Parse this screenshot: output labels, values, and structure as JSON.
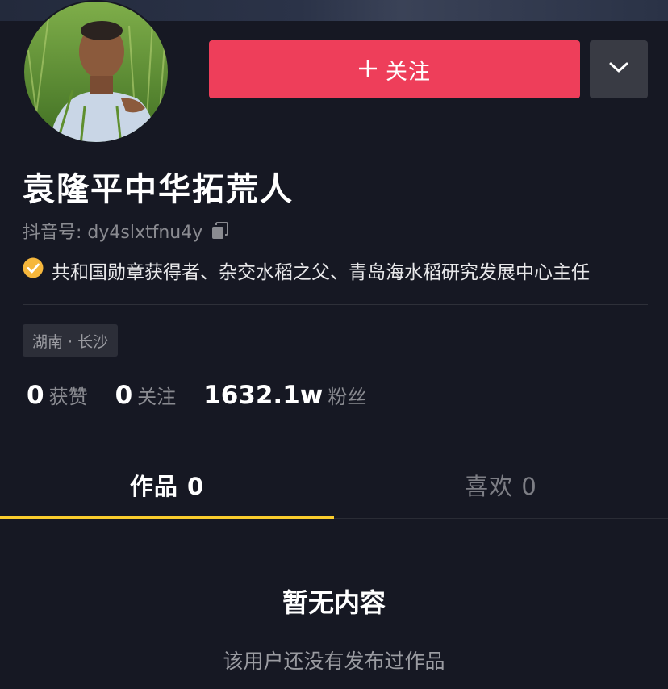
{
  "profile": {
    "nickname": "袁隆平中华拓荒人",
    "douyin_id_label": "抖音号: dy4slxtfnu4y",
    "verification": "共和国勋章获得者、杂交水稻之父、青岛海水稻研究发展中心主任",
    "location": "湖南 · 长沙"
  },
  "actions": {
    "follow_label": "关注",
    "follow_icon": "plus-icon",
    "more_icon": "chevron-down-icon"
  },
  "stats": [
    {
      "value": "0",
      "label": "获赞"
    },
    {
      "value": "0",
      "label": "关注"
    },
    {
      "value": "1632.1w",
      "label": "粉丝"
    }
  ],
  "tabs": [
    {
      "label": "作品 0"
    },
    {
      "label": "喜欢 0"
    }
  ],
  "empty_state": {
    "title": "暂无内容",
    "subtitle": "该用户还没有发布过作品"
  },
  "colors": {
    "background": "#161823",
    "follow_button": "#ee3e5a",
    "tab_indicator": "#facd2d",
    "verified_badge": "#f6b73c"
  }
}
